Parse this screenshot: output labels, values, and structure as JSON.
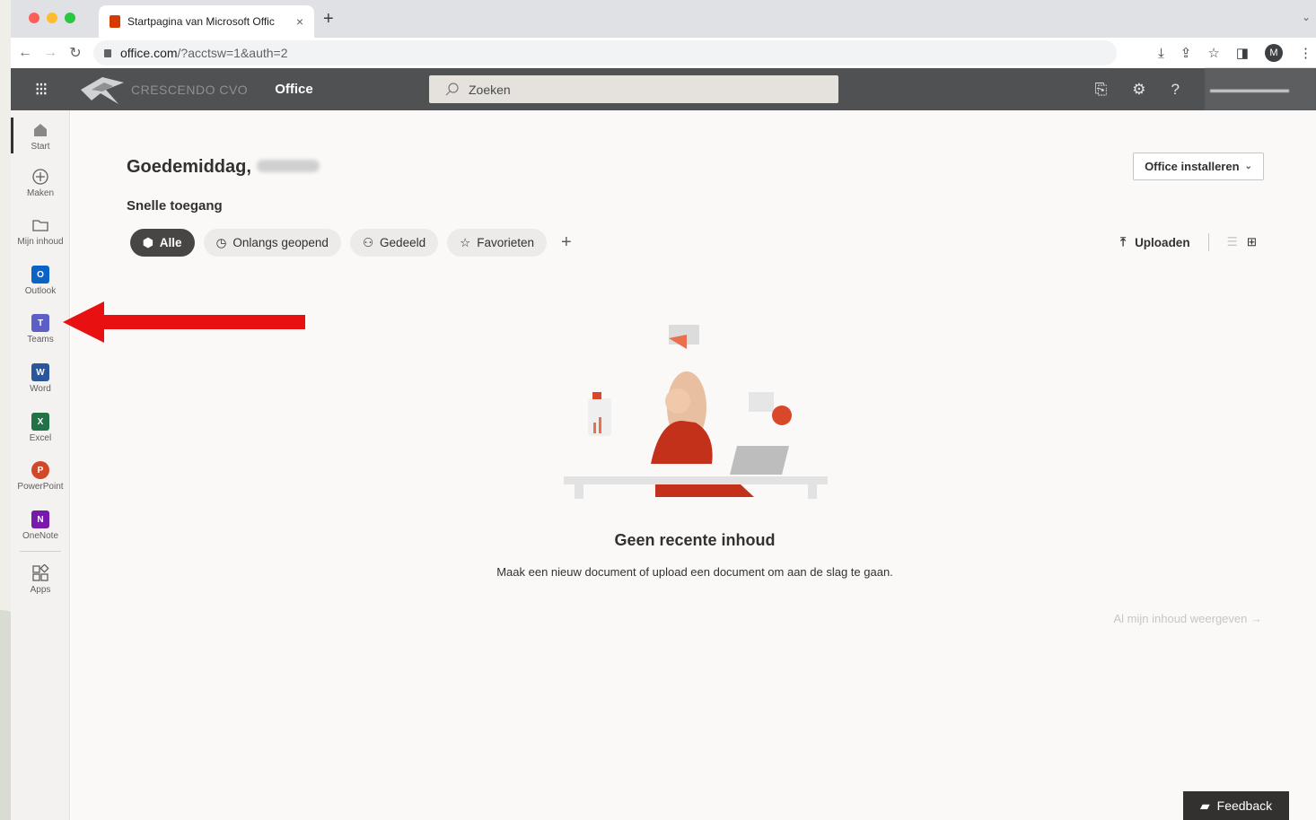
{
  "browser": {
    "tab_title": "Startpagina van Microsoft Offic",
    "tab_close": "×",
    "new_tab": "+",
    "url_host": "office.com",
    "url_path": "/?acctsw=1&auth=2",
    "profile_initial": "M"
  },
  "header": {
    "org_name": "CRESCENDO CVO",
    "app_name": "Office",
    "search_placeholder": "Zoeken",
    "help_label": "?"
  },
  "rail": {
    "items": [
      {
        "label": "Start",
        "icon": "home-icon"
      },
      {
        "label": "Maken",
        "icon": "plus-circle-icon"
      },
      {
        "label": "Mijn inhoud",
        "icon": "folder-icon"
      },
      {
        "label": "Outlook",
        "icon": "outlook-icon",
        "letter": "O",
        "color": "#0a64c8"
      },
      {
        "label": "Teams",
        "icon": "teams-icon",
        "letter": "T",
        "color": "#5b5fc7"
      },
      {
        "label": "Word",
        "icon": "word-icon",
        "letter": "W",
        "color": "#2b579a"
      },
      {
        "label": "Excel",
        "icon": "excel-icon",
        "letter": "X",
        "color": "#217346"
      },
      {
        "label": "PowerPoint",
        "icon": "powerpoint-icon",
        "letter": "P",
        "color": "#d24726"
      },
      {
        "label": "OneNote",
        "icon": "onenote-icon",
        "letter": "N",
        "color": "#7719aa"
      },
      {
        "label": "Apps",
        "icon": "apps-icon"
      }
    ]
  },
  "main": {
    "greeting": "Goedemiddag,",
    "install_button": "Office installeren",
    "quick_access": "Snelle toegang",
    "filters": [
      "Alle",
      "Onlangs geopend",
      "Gedeeld",
      "Favorieten"
    ],
    "add_filter": "+",
    "upload_label": "Uploaden",
    "empty_title": "Geen recente inhoud",
    "empty_subtitle": "Maak een nieuw document of upload een document om aan de slag te gaan.",
    "all_content_link": "Al mijn inhoud weergeven",
    "feedback_button": "Feedback"
  },
  "colors": {
    "header_bg": "#4f5153",
    "annotation_arrow": "#e81010"
  }
}
